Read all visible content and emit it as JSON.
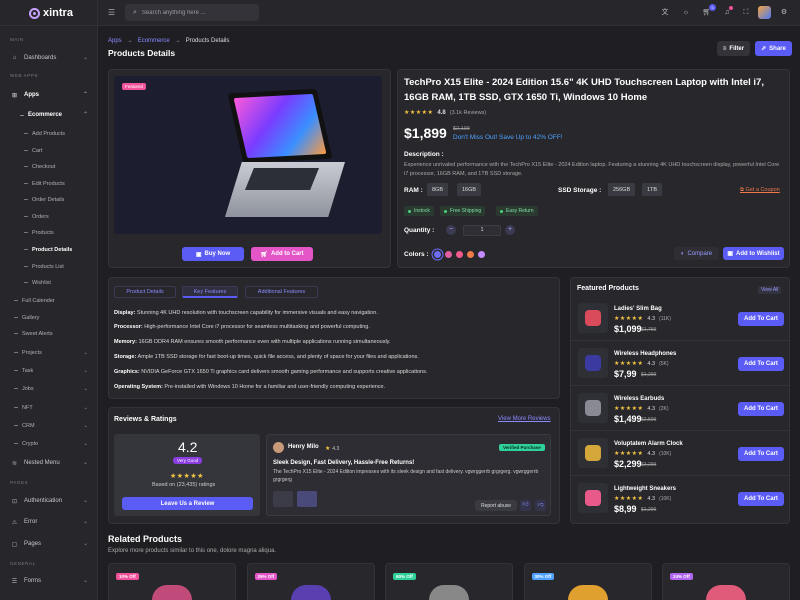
{
  "brand": {
    "name": "xintra"
  },
  "sidebar": {
    "sections": {
      "main": "MAIN",
      "web_apps": "WEB APPS",
      "pages": "PAGES",
      "general": "GENERAL"
    },
    "dashboards": "Dashboards",
    "apps": "Apps",
    "ecommerce": "Ecommerce",
    "ecom_items": [
      "Add Products",
      "Cart",
      "Checkout",
      "Edit Products",
      "Order Details",
      "Orders",
      "Products",
      "Product Details",
      "Products List",
      "Wishlist"
    ],
    "items": [
      "Full Calender",
      "Gallery",
      "Sweet Alerts",
      "Projects",
      "Task",
      "Jobs",
      "NFT",
      "CRM",
      "Crypto"
    ],
    "nested_menu": "Nested Menu",
    "authentication": "Authentication",
    "error": "Error",
    "pages": "Pages",
    "forms": "Forms"
  },
  "header": {
    "search_placeholder": "Search anything here ...",
    "cart_count": "5"
  },
  "breadcrumb": {
    "apps": "Apps",
    "ecommerce": "Ecommerce",
    "current": "Products Details"
  },
  "page_title": "Products Details",
  "actions": {
    "filter": "Filter",
    "share": "Share"
  },
  "product": {
    "tag": "Featured",
    "title": "TechPro X15 Elite - 2024 Edition 15.6\" 4K UHD Touchscreen Laptop with Intel i7, 16GB RAM, 1TB SSD, GTX 1650 Ti, Windows 10 Home",
    "rating": "4.8",
    "reviews": "(3.1k Reviews)",
    "price": "$1,899",
    "old_price": "$2,199",
    "promo": "Don't Miss Out! Save Up to 42% OFF!",
    "desc_label": "Description :",
    "description": "Experience unrivaled performance with the TechPro X15 Elite - 2024 Edition laptop. Featuring a stunning 4K UHD touchscreen display, powerful Intel Core i7 processor, 16GB RAM, and 1TB SSD storage.",
    "ram_label": "RAM :",
    "ram": [
      "8GB",
      "16GB"
    ],
    "ssd_label": "SSD Storage :",
    "ssd": [
      "256GB",
      "1TB"
    ],
    "coupon": "Get a Coupon",
    "status": [
      "Instock",
      "Free Shipping",
      "Easy Return"
    ],
    "qty_label": "Quantity :",
    "qty": "1",
    "colors_label": "Colors :",
    "colors": [
      "#6c6cf5",
      "#e05fa0",
      "#f05a8c",
      "#f07a4a",
      "#c48cff"
    ],
    "buy_now": "Buy Now",
    "add_to_cart": "Add to Cart",
    "compare": "Compare",
    "wishlist": "Add to Wishlist"
  },
  "tabs": [
    "Product Details",
    "Key Features",
    "Additional Features"
  ],
  "features": [
    {
      "k": "Display:",
      "v": " Stunning 4K UHD resolution with touchscreen capability for immersive visuals and easy navigation."
    },
    {
      "k": "Processor:",
      "v": " High-performance Intel Core i7 processor for seamless multitasking and powerful computing."
    },
    {
      "k": "Memory:",
      "v": " 16GB DDR4 RAM ensures smooth performance even with multiple applications running simultaneously."
    },
    {
      "k": "Storage:",
      "v": " Ample 1TB SSD storage for fast boot-up times, quick file access, and plenty of space for your files and applications."
    },
    {
      "k": "Graphics:",
      "v": " NVIDIA GeForce GTX 1650 Ti graphics card delivers smooth gaming performance and supports creative applications."
    },
    {
      "k": "Operating System:",
      "v": " Pre-installed with Windows 10 Home for a familiar and user-friendly computing experience."
    }
  ],
  "reviews": {
    "title": "Reviews & Ratings",
    "view_more": "View More Reviews",
    "avg": "4.2",
    "badge": "Very Good",
    "based_on": "Based on (23,435) ratings",
    "leave": "Leave Us a Review",
    "name": "Henry Milo",
    "score": "4.3",
    "verified": "Verified Purchase",
    "headline": "Sleek Design, Fast Delivery, Hassle-Free Returns!",
    "body": "The TechPro X15 Elite - 2024 Edition impresses with its sleek design and fast delivery. vgwrggerrb grgrgerg. vgwrggerrb grgrgerg",
    "report": "Report abuse"
  },
  "featured": {
    "title": "Featured Products",
    "view_all": "View All",
    "items": [
      {
        "name": "Ladies' Slim Bag",
        "rating": "4.3",
        "count": "(11K)",
        "price": "$1,099",
        "old": "$1,759",
        "btn": "Add To Cart"
      },
      {
        "name": "Wireless Headphones",
        "rating": "4.3",
        "count": "(5K)",
        "price": "$7,99",
        "old": "$1,299",
        "btn": "Add To Cart"
      },
      {
        "name": "Wireless Earbuds",
        "rating": "4.3",
        "count": "(2K)",
        "price": "$1,499",
        "old": "$2,599",
        "btn": "Add To Cart"
      },
      {
        "name": "Voluptatem Alarm Clock",
        "rating": "4.3",
        "count": "(10K)",
        "price": "$2,299",
        "old": "$3,299",
        "btn": "Add To Cart"
      },
      {
        "name": "Lightweight Sneakers",
        "rating": "4.3",
        "count": "(10K)",
        "price": "$8,99",
        "old": "$1,299",
        "btn": "Add To Cart"
      }
    ]
  },
  "related": {
    "title": "Related Products",
    "subtitle": "Explore more products similar to this one, dolore magna aliqua.",
    "offers": [
      "10% Off",
      "25% Off",
      "60% Off",
      "30% Off",
      "24% Off"
    ],
    "offer_colors": [
      "#f0539b",
      "#e456c7",
      "#2fd19a",
      "#4fa3ff",
      "#b066f0"
    ]
  }
}
